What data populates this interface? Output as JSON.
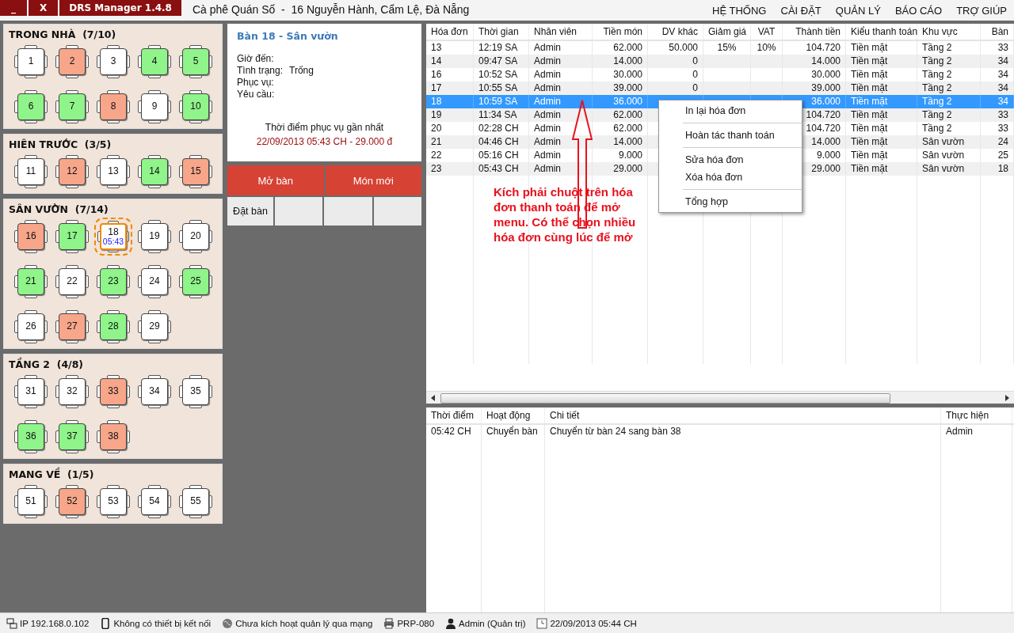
{
  "window": {
    "minimize": "_",
    "close": "X",
    "app_title": "DRS Manager 1.4.8",
    "shop": "Cà phê Quán Số  -  16 Nguyễn Hành, Cẩm Lệ, Đà Nẵng"
  },
  "menu": [
    "HỆ THỐNG",
    "CÀI ĐẶT",
    "QUẢN LÝ",
    "BÁO CÁO",
    "TRỢ GIÚP"
  ],
  "areas": [
    {
      "title": "TRONG NHÀ  (7/10)",
      "tables": [
        {
          "number": "1",
          "color": "#ffffff",
          "selected": false
        },
        {
          "number": "2",
          "color": "#f7a68a",
          "selected": false
        },
        {
          "number": "3",
          "color": "#ffffff",
          "selected": false
        },
        {
          "number": "4",
          "color": "#8ff48a",
          "selected": false
        },
        {
          "number": "5",
          "color": "#8ff48a",
          "selected": false
        },
        {
          "number": "6",
          "color": "#8ff48a",
          "selected": false
        },
        {
          "number": "7",
          "color": "#8ff48a",
          "selected": false
        },
        {
          "number": "8",
          "color": "#f7a68a",
          "selected": false
        },
        {
          "number": "9",
          "color": "#ffffff",
          "selected": false
        },
        {
          "number": "10",
          "color": "#8ff48a",
          "selected": false
        }
      ]
    },
    {
      "title": "HIÊN TRƯỚC  (3/5)",
      "tables": [
        {
          "number": "11",
          "color": "#ffffff",
          "selected": false
        },
        {
          "number": "12",
          "color": "#f7a68a",
          "selected": false
        },
        {
          "number": "13",
          "color": "#ffffff",
          "selected": false
        },
        {
          "number": "14",
          "color": "#8ff48a",
          "selected": false
        },
        {
          "number": "15",
          "color": "#f7a68a",
          "selected": false
        }
      ]
    },
    {
      "title": "SÂN VƯỜN  (7/14)",
      "tables": [
        {
          "number": "16",
          "color": "#f7a68a",
          "selected": false
        },
        {
          "number": "17",
          "color": "#8ff48a",
          "selected": false
        },
        {
          "number": "18",
          "color": "#ffffff",
          "selected": true,
          "time": "05:43"
        },
        {
          "number": "19",
          "color": "#ffffff",
          "selected": false
        },
        {
          "number": "20",
          "color": "#ffffff",
          "selected": false
        },
        {
          "number": "21",
          "color": "#8ff48a",
          "selected": false
        },
        {
          "number": "22",
          "color": "#ffffff",
          "selected": false
        },
        {
          "number": "23",
          "color": "#8ff48a",
          "selected": false
        },
        {
          "number": "24",
          "color": "#ffffff",
          "selected": false
        },
        {
          "number": "25",
          "color": "#8ff48a",
          "selected": false
        },
        {
          "number": "26",
          "color": "#ffffff",
          "selected": false
        },
        {
          "number": "27",
          "color": "#f7a68a",
          "selected": false
        },
        {
          "number": "28",
          "color": "#8ff48a",
          "selected": false
        },
        {
          "number": "29",
          "color": "#ffffff",
          "selected": false
        }
      ]
    },
    {
      "title": "TẦNG 2  (4/8)",
      "tables": [
        {
          "number": "31",
          "color": "#ffffff",
          "selected": false
        },
        {
          "number": "32",
          "color": "#ffffff",
          "selected": false
        },
        {
          "number": "33",
          "color": "#f7a68a",
          "selected": false
        },
        {
          "number": "34",
          "color": "#ffffff",
          "selected": false
        },
        {
          "number": "35",
          "color": "#ffffff",
          "selected": false
        },
        {
          "number": "36",
          "color": "#8ff48a",
          "selected": false
        },
        {
          "number": "37",
          "color": "#8ff48a",
          "selected": false
        },
        {
          "number": "38",
          "color": "#f7a68a",
          "selected": false
        }
      ]
    },
    {
      "title": "MANG VỀ  (1/5)",
      "tables": [
        {
          "number": "51",
          "color": "#ffffff",
          "selected": false
        },
        {
          "number": "52",
          "color": "#f7a68a",
          "selected": false
        },
        {
          "number": "53",
          "color": "#ffffff",
          "selected": false
        },
        {
          "number": "54",
          "color": "#ffffff",
          "selected": false
        },
        {
          "number": "55",
          "color": "#ffffff",
          "selected": false
        }
      ]
    }
  ],
  "detail": {
    "title": "Bàn 18 - Sân vườn",
    "fields": [
      {
        "label": "Giờ đến:"
      },
      {
        "label": "Tình trạng:",
        "value": "Trống"
      },
      {
        "label": "Phục vụ:"
      },
      {
        "label": "Yêu cầu:"
      }
    ],
    "last_service_label": "Thời điểm phục vụ gần nhất",
    "last_service": "22/09/2013 05:43 CH - 29.000 đ"
  },
  "actions": [
    {
      "label": "Mở bàn",
      "kind": "primary"
    },
    {
      "label": "Món mới",
      "kind": "primary"
    }
  ],
  "secondary_actions": [
    {
      "label": "Đặt bàn",
      "kind": "button"
    },
    {
      "kind": "blank"
    },
    {
      "kind": "blank"
    },
    {
      "kind": "blank"
    }
  ],
  "invoices": {
    "columns": [
      "Hóa đơn",
      "Thời gian",
      "Nhân viên",
      "Tiền món",
      "DV khác",
      "Giảm giá",
      "VAT",
      "Thành tiền",
      "Kiểu thanh toán",
      "Khu vực",
      "Bàn"
    ],
    "rows": [
      {
        "selected": false,
        "cells": [
          "13",
          "12:19 SA",
          "Admin",
          "62.000",
          "50.000",
          "15%",
          "10%",
          "104.720",
          "Tiền mặt",
          "Tầng 2",
          "33"
        ]
      },
      {
        "selected": false,
        "cells": [
          "14",
          "09:47 SA",
          "Admin",
          "14.000",
          "0",
          null,
          null,
          "14.000",
          "Tiền mặt",
          "Tầng 2",
          "34"
        ]
      },
      {
        "selected": false,
        "cells": [
          "16",
          "10:52 SA",
          "Admin",
          "30.000",
          "0",
          null,
          null,
          "30.000",
          "Tiền mặt",
          "Tầng 2",
          "34"
        ]
      },
      {
        "selected": false,
        "cells": [
          "17",
          "10:55 SA",
          "Admin",
          "39.000",
          "0",
          null,
          null,
          "39.000",
          "Tiền mặt",
          "Tầng 2",
          "34"
        ]
      },
      {
        "selected": true,
        "cells": [
          "18",
          "10:59 SA",
          "Admin",
          "36.000",
          null,
          null,
          null,
          "36.000",
          "Tiền mặt",
          "Tầng 2",
          "34"
        ]
      },
      {
        "selected": false,
        "cells": [
          "19",
          "11:34 SA",
          "Admin",
          "62.000",
          null,
          null,
          null,
          "104.720",
          "Tiền mặt",
          "Tầng 2",
          "33"
        ]
      },
      {
        "selected": false,
        "cells": [
          "20",
          "02:28 CH",
          "Admin",
          "62.000",
          null,
          null,
          null,
          "104.720",
          "Tiền mặt",
          "Tầng 2",
          "33"
        ]
      },
      {
        "selected": false,
        "cells": [
          "21",
          "04:46 CH",
          "Admin",
          "14.000",
          null,
          null,
          null,
          "14.000",
          "Tiền mặt",
          "Sân vườn",
          "24"
        ]
      },
      {
        "selected": false,
        "cells": [
          "22",
          "05:16 CH",
          "Admin",
          "9.000",
          null,
          null,
          null,
          "9.000",
          "Tiền mặt",
          "Sân vườn",
          "25"
        ]
      },
      {
        "selected": false,
        "cells": [
          "23",
          "05:43 CH",
          "Admin",
          "29.000",
          null,
          null,
          null,
          "29.000",
          "Tiền mặt",
          "Sân vườn",
          "18"
        ]
      }
    ]
  },
  "context_menu": [
    {
      "kind": "item",
      "label": "In lại hóa đơn"
    },
    {
      "kind": "separator"
    },
    {
      "kind": "item",
      "label": "Hoàn tác thanh toán"
    },
    {
      "kind": "separator"
    },
    {
      "kind": "item",
      "label": "Sửa hóa đơn"
    },
    {
      "kind": "item",
      "label": "Xóa hóa đơn"
    },
    {
      "kind": "separator"
    },
    {
      "kind": "item",
      "label": "Tổng hợp"
    }
  ],
  "annotation": {
    "text": "Kích phải chuột trên hóa đơn thanh toán để mở menu. Có thể chọn nhiều hóa đơn cùng lúc để mở"
  },
  "log": {
    "columns": [
      "Thời điểm",
      "Hoạt động",
      "Chi tiết",
      "Thực hiện"
    ],
    "rows": [
      {
        "cells": [
          "05:42 CH",
          "Chuyển bàn",
          "Chuyển từ bàn 24 sang bàn 38",
          "Admin"
        ]
      }
    ]
  },
  "status_bar": [
    {
      "kind": "network",
      "text": "IP 192.168.0.102"
    },
    {
      "kind": "device",
      "text": "Không có thiết bị kết nối"
    },
    {
      "kind": "globe",
      "text": "Chưa kích hoạt quản lý qua mạng"
    },
    {
      "kind": "printer",
      "text": "PRP-080"
    },
    {
      "kind": "user",
      "text": "Admin (Quản trị)"
    },
    {
      "kind": "calendar",
      "text": "22/09/2013 05:44 CH"
    }
  ]
}
